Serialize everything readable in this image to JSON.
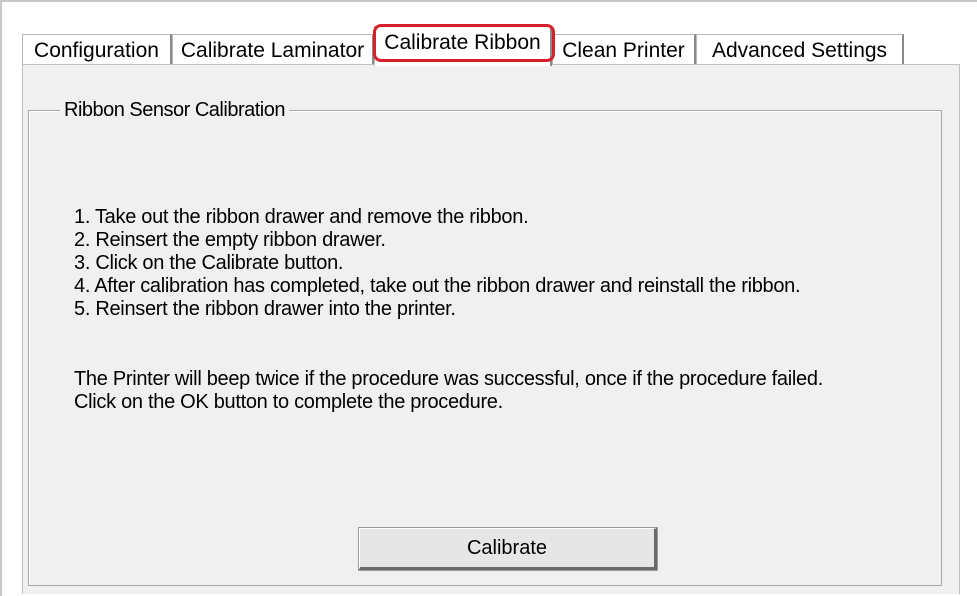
{
  "tabs": [
    {
      "label": "Configuration",
      "selected": false
    },
    {
      "label": "Calibrate Laminator",
      "selected": false
    },
    {
      "label": "Calibrate Ribbon",
      "selected": true
    },
    {
      "label": "Clean Printer",
      "selected": false
    },
    {
      "label": "Advanced Settings",
      "selected": false
    }
  ],
  "highlight_color": "#d8202a",
  "group": {
    "title": "Ribbon Sensor Calibration"
  },
  "steps": [
    "1. Take out the ribbon drawer and remove the ribbon.",
    "2. Reinsert the empty ribbon drawer.",
    "3. Click on the Calibrate button.",
    "4. After calibration has completed, take out the ribbon drawer and reinstall the ribbon.",
    "5. Reinsert the ribbon drawer into the printer."
  ],
  "notes": [
    "The Printer will beep twice if the procedure was successful, once if the procedure failed.",
    "Click on the OK button to complete the procedure."
  ],
  "calibrate_button": {
    "label": "Calibrate"
  }
}
